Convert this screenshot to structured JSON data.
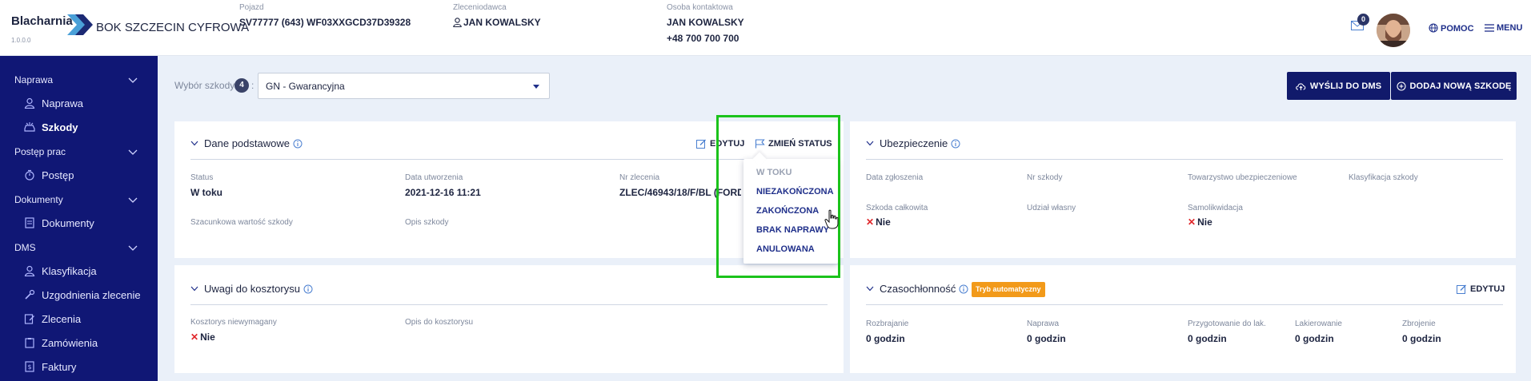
{
  "header": {
    "logo_name": "Blacharnia",
    "logo_version": "1.0.0.0",
    "app_title": "BOK SZCZECIN CYFROWA",
    "vehicle_label": "Pojazd",
    "vehicle_value": "SV77777 (643) WF03XXGCD37D39328",
    "client_label": "Zleceniodawca",
    "client_value": "JAN KOWALSKY",
    "contact_label": "Osoba kontaktowa",
    "contact_name": "JAN KOWALSKY",
    "contact_phone": "+48 700 700 700",
    "mail_count": "0",
    "help_label": "POMOC",
    "menu_label": "MENU"
  },
  "sidebar": {
    "sections": [
      {
        "label": "Naprawa",
        "items": [
          "Naprawa",
          "Szkody"
        ]
      },
      {
        "label": "Postęp prac",
        "items": [
          "Postęp"
        ]
      },
      {
        "label": "Dokumenty",
        "items": [
          "Dokumenty"
        ]
      },
      {
        "label": "DMS",
        "items": [
          "Klasyfikacja",
          "Uzgodnienia zlecenie",
          "Zlecenia",
          "Zamówienia",
          "Faktury"
        ]
      }
    ],
    "active_item": "Szkody"
  },
  "toolbar": {
    "damage_select_label": "Wybór szkody",
    "damage_count": "4",
    "colon": ":",
    "damage_selected": "GN - Gwarancyjna",
    "send_dms_label": "WYŚLIJ DO DMS",
    "add_damage_label": "DODAJ NOWĄ SZKODĘ"
  },
  "basic": {
    "title": "Dane podstawowe",
    "edit_label": "EDYTUJ",
    "change_status_label": "ZMIEŃ STATUS",
    "status_label": "Status",
    "status_value": "W toku",
    "created_label": "Data utworzenia",
    "created_value": "2021-12-16 11:21",
    "order_label": "Nr zlecenia",
    "order_value": "ZLEC/46943/18/F/BL (FORD F",
    "estimated_label": "Szacunkowa wartość szkody",
    "description_label": "Opis szkody"
  },
  "status_menu": {
    "items": [
      {
        "label": "W TOKU",
        "disabled": true
      },
      {
        "label": "NIEZAKOŃCZONA",
        "disabled": false
      },
      {
        "label": "ZAKOŃCZONA",
        "disabled": false
      },
      {
        "label": "BRAK NAPRAWY",
        "disabled": false
      },
      {
        "label": "ANULOWANA",
        "disabled": false
      }
    ]
  },
  "insurance": {
    "title": "Ubezpieczenie",
    "report_date_label": "Data zgłoszenia",
    "damage_no_label": "Nr szkody",
    "insurer_label": "Towarzystwo ubezpieczeniowe",
    "classification_label": "Klasyfikacja szkody",
    "total_loss_label": "Szkoda całkowita",
    "total_loss_value": "Nie",
    "own_share_label": "Udział własny",
    "self_liquidation_label": "Samolikwidacja",
    "self_liquidation_value": "Nie"
  },
  "notes": {
    "title": "Uwagi do kosztorysu",
    "not_required_label": "Kosztorys niewymagany",
    "not_required_value": "Nie",
    "description_label": "Opis do kosztorysu"
  },
  "labor": {
    "title": "Czasochłonność",
    "mode_badge": "Tryb automatyczny",
    "edit_label": "EDYTUJ",
    "columns": [
      {
        "label": "Rozbrajanie",
        "value": "0 godzin"
      },
      {
        "label": "Naprawa",
        "value": "0 godzin"
      },
      {
        "label": "Przygotowanie do lak.",
        "value": "0 godzin"
      },
      {
        "label": "Lakierowanie",
        "value": "0 godzin"
      },
      {
        "label": "Zbrojenie",
        "value": "0 godzin"
      }
    ]
  },
  "colors": {
    "sidebar": "#101775",
    "primary_button": "#111a6b",
    "accent": "#1f2f8a",
    "highlight": "#1bc31b",
    "badge": "#f29a1a"
  }
}
